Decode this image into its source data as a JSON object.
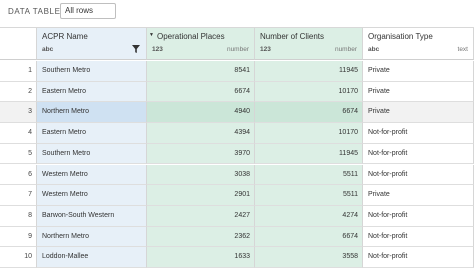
{
  "toolbar": {
    "title": "DATA TABLE",
    "rows_select": "All rows"
  },
  "columns": {
    "acpr": {
      "name": "ACPR Name",
      "type": "abc"
    },
    "ops": {
      "name": "Operational Places",
      "type": "123",
      "type_name": "number"
    },
    "cli": {
      "name": "Number of Clients",
      "type": "123",
      "type_name": "number"
    },
    "org": {
      "name": "Organisation Type",
      "type": "abc",
      "type_name": "text"
    }
  },
  "rows": [
    {
      "idx": "1",
      "acpr": "Southern Metro",
      "ops": "8541",
      "cli": "11945",
      "org": "Private"
    },
    {
      "idx": "2",
      "acpr": "Eastern Metro",
      "ops": "6674",
      "cli": "10170",
      "org": "Private"
    },
    {
      "idx": "3",
      "acpr": "Northern Metro",
      "ops": "4940",
      "cli": "6674",
      "org": "Private"
    },
    {
      "idx": "4",
      "acpr": "Eastern Metro",
      "ops": "4394",
      "cli": "10170",
      "org": "Not-for-profit"
    },
    {
      "idx": "5",
      "acpr": "Southern Metro",
      "ops": "3970",
      "cli": "11945",
      "org": "Not-for-profit"
    },
    {
      "idx": "6",
      "acpr": "Western Metro",
      "ops": "3038",
      "cli": "5511",
      "org": "Not-for-profit"
    },
    {
      "idx": "7",
      "acpr": "Western Metro",
      "ops": "2901",
      "cli": "5511",
      "org": "Private"
    },
    {
      "idx": "8",
      "acpr": "Barwon-South Western",
      "ops": "2427",
      "cli": "4274",
      "org": "Not-for-profit"
    },
    {
      "idx": "9",
      "acpr": "Northern Metro",
      "ops": "2362",
      "cli": "6674",
      "org": "Not-for-profit"
    },
    {
      "idx": "10",
      "acpr": "Loddon-Mallee",
      "ops": "1633",
      "cli": "3558",
      "org": "Not-for-profit"
    }
  ],
  "selected_row": "3",
  "colors": {
    "acpr_bg": "#e7f0f8",
    "number_bg": "#dcefe5",
    "selected_bg": "#cfe1f2"
  },
  "icons": {
    "filter": "filter-icon",
    "sort": "sort-descending-icon"
  }
}
